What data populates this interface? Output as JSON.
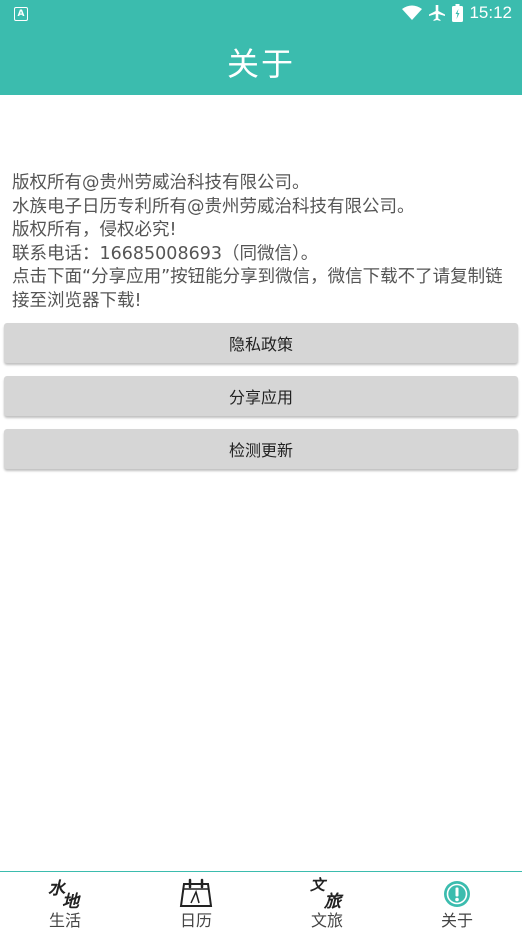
{
  "status_bar": {
    "time": "15:12",
    "notification_glyph": "A"
  },
  "app_bar": {
    "title": "关于"
  },
  "content": {
    "lines": [
      "版权所有@贵州劳威治科技有限公司。",
      "水族电子日历专利所有@贵州劳威治科技有限公司。",
      "版权所有，侵权必究!",
      "联系电话：16685008693（同微信）。",
      "点击下面“分享应用”按钮能分享到微信，微信下载不了请复制链接至浏览器下载!"
    ]
  },
  "buttons": {
    "privacy": "隐私政策",
    "share": "分享应用",
    "update": "检测更新"
  },
  "bottom_nav": {
    "items": [
      {
        "label": "生活",
        "icon": "shui-di-calligraphy-icon",
        "glyphs": [
          "水",
          "地"
        ]
      },
      {
        "label": "日历",
        "icon": "calendar-icon"
      },
      {
        "label": "文旅",
        "icon": "wen-lv-calligraphy-icon",
        "glyphs": [
          "文",
          "旅"
        ]
      },
      {
        "label": "关于",
        "icon": "info-icon",
        "active": true
      }
    ]
  },
  "colors": {
    "primary": "#3bbcae",
    "button_bg": "#d6d6d6",
    "text": "#555555"
  }
}
